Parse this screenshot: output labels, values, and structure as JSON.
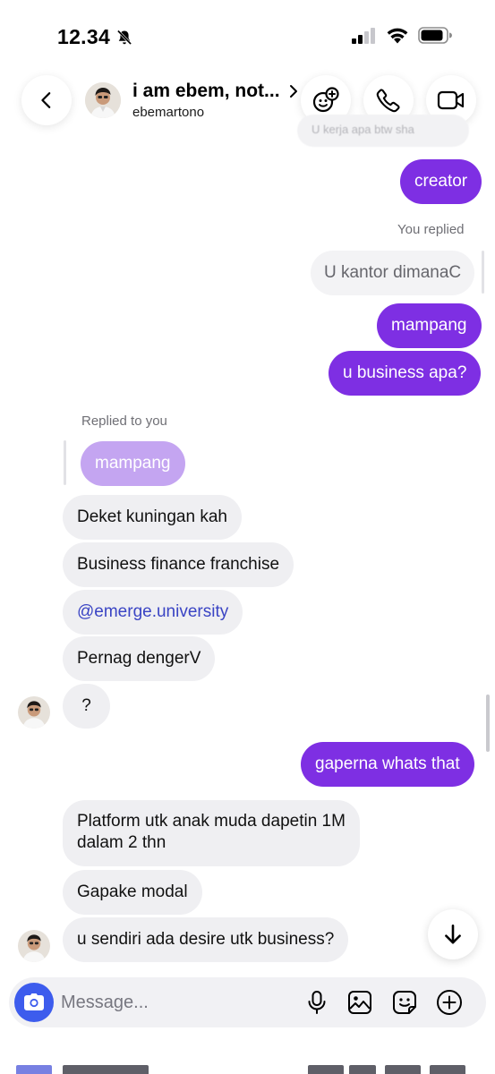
{
  "status_bar": {
    "time": "12.34"
  },
  "header": {
    "title": "i am ebem, not...",
    "subtitle": "ebemartono"
  },
  "ghost_preview": "U kerja apa btw sha",
  "messages": {
    "creator": "creator",
    "you_replied_label": "You replied",
    "quoted_self": "U kantor dimanaC",
    "mampang_out": "mampang",
    "business_q": "u business apa?",
    "replied_to_you_label": "Replied to you",
    "quoted_mampang": "mampang",
    "deket": "Deket kuningan kah",
    "business_finance": "Business finance franchise",
    "handle": "@emerge.university",
    "pernag": "Pernag dengerV",
    "question": "?",
    "gaperna": "gaperna whats that",
    "platform_line1": "Platform utk anak muda dapetin 1M",
    "platform_line2": "dalam 2 thn",
    "gapake": "Gapake modal",
    "desire": "u sendiri ada desire utk business?"
  },
  "composer": {
    "placeholder": "Message..."
  },
  "colors": {
    "outgoing": "#7e2fe3",
    "incoming": "#efeff2",
    "link": "#3a44c4",
    "camera": "#3d5ced"
  },
  "icons": [
    "bell-slash-icon",
    "signal-icon",
    "wifi-icon",
    "battery-icon",
    "back-arrow-icon",
    "chevron-right-icon",
    "effects-icon",
    "phone-icon",
    "video-icon",
    "arrow-down-icon",
    "camera-icon",
    "microphone-icon",
    "gallery-icon",
    "sticker-icon",
    "plus-icon"
  ]
}
